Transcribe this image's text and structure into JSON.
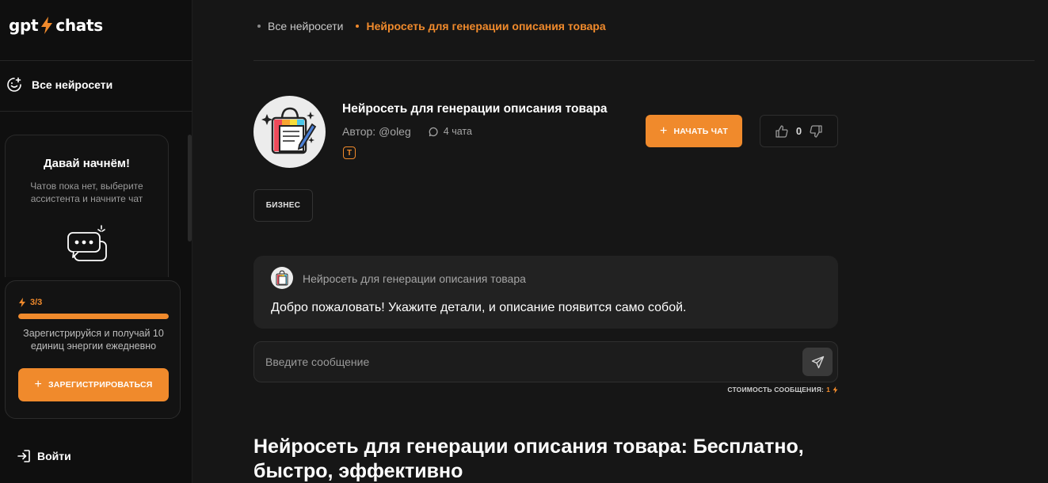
{
  "brand": {
    "left": "gpt",
    "right": "chats"
  },
  "sidebar": {
    "all_networks": "Все нейросети",
    "empty_title": "Давай начнём!",
    "empty_text": "Чатов пока нет, выберите ассистента и начните чат",
    "energy": {
      "label": "3/3",
      "used_fraction": 1.0,
      "text": "Зарегистрируйся и получай 10 единиц энергии ежедневно",
      "register_label": "ЗАРЕГИСТРИРОВАТЬСЯ"
    },
    "login_label": "Войти"
  },
  "breadcrumb": {
    "items": [
      "Все нейросети",
      "Нейросеть для генерации описания товара"
    ]
  },
  "bot": {
    "title": "Нейросеть для генерации описания товара",
    "author": "Автор: @oleg",
    "chats_count": "4 чата",
    "model_badge": "T",
    "start_label": "НАЧАТЬ ЧАТ",
    "votes": "0",
    "tag": "БИЗНЕС"
  },
  "greeting": {
    "name": "Нейросеть для генерации описания товара",
    "text": "Добро пожаловать! Укажите детали, и описание появится само собой."
  },
  "input": {
    "placeholder": "Введите сообщение"
  },
  "cost": {
    "label": "СТОИМОСТЬ СООБЩЕНИЯ:",
    "value": "1"
  },
  "article": {
    "title": "Нейросеть для генерации описания товара: Бесплатно, быстро, эффективно"
  },
  "colors": {
    "accent": "#f08a2c",
    "background": "#161616",
    "sidebar": "#0f0f0f"
  }
}
